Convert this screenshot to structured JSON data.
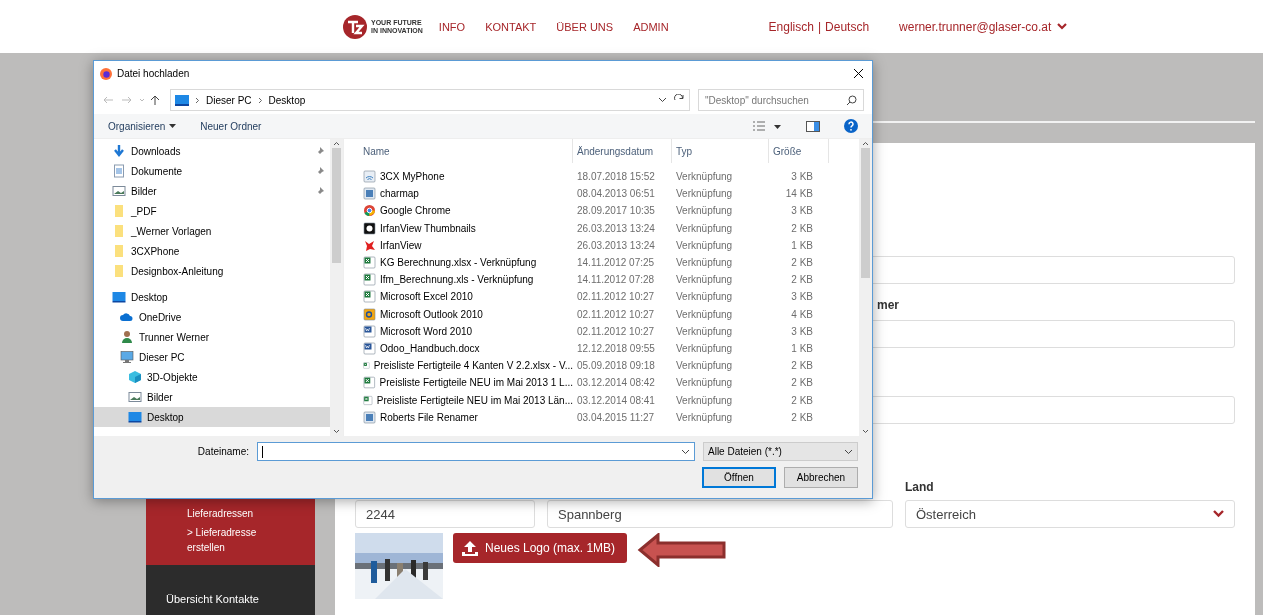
{
  "header": {
    "logo_tagline": [
      "YOUR FUTURE",
      "IN INNOVATION"
    ],
    "nav": [
      {
        "label": "INFO"
      },
      {
        "label": "KONTAKT"
      },
      {
        "label": "ÜBER UNS"
      },
      {
        "label": "ADMIN"
      }
    ],
    "languages": [
      "Englisch",
      "|",
      "Deutsch"
    ],
    "user": "werner.trunner@glaser-co.at"
  },
  "sidebar": {
    "red_links": [
      "Lieferadressen",
      "> Lieferadresse erstellen"
    ],
    "section_title": "Übersicht Kontakte"
  },
  "form": {
    "partial_label": "mer",
    "land_label": "Land",
    "plz_value": "2244",
    "ort_value": "Spannberg",
    "land_value": "Österreich",
    "upload_button": "Neues Logo (max. 1MB)"
  },
  "dialog": {
    "title": "Datei hochladen",
    "breadcrumb": [
      "Dieser PC",
      "Desktop"
    ],
    "search_placeholder": "\"Desktop\" durchsuchen",
    "toolbar": [
      "Organisieren",
      "Neuer Ordner"
    ],
    "quick_access": [
      {
        "label": "Downloads",
        "kind": "download",
        "pinned": true
      },
      {
        "label": "Dokumente",
        "kind": "document",
        "pinned": true
      },
      {
        "label": "Bilder",
        "kind": "pictures",
        "pinned": true
      },
      {
        "label": "_PDF",
        "kind": "folder",
        "pinned": false
      },
      {
        "label": "_Werner Vorlagen",
        "kind": "folder",
        "pinned": false
      },
      {
        "label": "3CXPhone",
        "kind": "folder",
        "pinned": false
      },
      {
        "label": "Designbox-Anleitung",
        "kind": "folder",
        "pinned": false
      }
    ],
    "tree": [
      {
        "label": "Desktop",
        "kind": "desktop",
        "selected": false,
        "children": [
          {
            "label": "OneDrive",
            "kind": "cloud",
            "selected": false
          },
          {
            "label": "Trunner Werner",
            "kind": "user",
            "selected": false
          },
          {
            "label": "Dieser PC",
            "kind": "pc",
            "selected": false,
            "children": [
              {
                "label": "3D-Objekte",
                "kind": "cube",
                "selected": false
              },
              {
                "label": "Bilder",
                "kind": "pictures",
                "selected": false
              },
              {
                "label": "Desktop",
                "kind": "desktop",
                "selected": true
              }
            ]
          }
        ]
      }
    ],
    "columns": [
      "Name",
      "Änderungsdatum",
      "Typ",
      "Größe"
    ],
    "files": [
      {
        "name": "3CX MyPhone",
        "date": "18.07.2018 15:52",
        "type": "Verknüpfung",
        "size": "3 KB",
        "kind": "phone"
      },
      {
        "name": "charmap",
        "date": "08.04.2013 06:51",
        "type": "Verknüpfung",
        "size": "14 KB",
        "kind": "app"
      },
      {
        "name": "Google Chrome",
        "date": "28.09.2017 10:35",
        "type": "Verknüpfung",
        "size": "3 KB",
        "kind": "browser"
      },
      {
        "name": "IrfanView Thumbnails",
        "date": "26.03.2013 13:24",
        "type": "Verknüpfung",
        "size": "2 KB",
        "kind": "viewer"
      },
      {
        "name": "IrfanView",
        "date": "26.03.2013 13:24",
        "type": "Verknüpfung",
        "size": "1 KB",
        "kind": "viewer2"
      },
      {
        "name": "KG Berechnung.xlsx - Verknüpfung",
        "date": "14.11.2012 07:25",
        "type": "Verknüpfung",
        "size": "2 KB",
        "kind": "excel"
      },
      {
        "name": "Ifm_Berechnung.xls - Verknüpfung",
        "date": "14.11.2012 07:28",
        "type": "Verknüpfung",
        "size": "2 KB",
        "kind": "excel"
      },
      {
        "name": "Microsoft Excel 2010",
        "date": "02.11.2012 10:27",
        "type": "Verknüpfung",
        "size": "3 KB",
        "kind": "excel"
      },
      {
        "name": "Microsoft Outlook 2010",
        "date": "02.11.2012 10:27",
        "type": "Verknüpfung",
        "size": "4 KB",
        "kind": "outlook"
      },
      {
        "name": "Microsoft Word 2010",
        "date": "02.11.2012 10:27",
        "type": "Verknüpfung",
        "size": "3 KB",
        "kind": "word"
      },
      {
        "name": "Odoo_Handbuch.docx",
        "date": "12.12.2018 09:55",
        "type": "Verknüpfung",
        "size": "1 KB",
        "kind": "word"
      },
      {
        "name": "Preisliste Fertigteile 4 Kanten V 2.2.xlsx - V...",
        "date": "05.09.2018 09:18",
        "type": "Verknüpfung",
        "size": "2 KB",
        "kind": "excel"
      },
      {
        "name": "Preisliste Fertigteile NEU im Mai 2013 1 L...",
        "date": "03.12.2014 08:42",
        "type": "Verknüpfung",
        "size": "2 KB",
        "kind": "excel"
      },
      {
        "name": "Preisliste Fertigteile NEU im Mai 2013 Län...",
        "date": "03.12.2014 08:41",
        "type": "Verknüpfung",
        "size": "2 KB",
        "kind": "excel"
      },
      {
        "name": "Roberts File Renamer",
        "date": "03.04.2015 11:27",
        "type": "Verknüpfung",
        "size": "2 KB",
        "kind": "app"
      }
    ],
    "filename_label": "Dateiname:",
    "filter": "Alle Dateien (*.*)",
    "buttons": [
      {
        "label": "Öffnen",
        "default": true
      },
      {
        "label": "Abbrechen",
        "default": false
      }
    ]
  }
}
